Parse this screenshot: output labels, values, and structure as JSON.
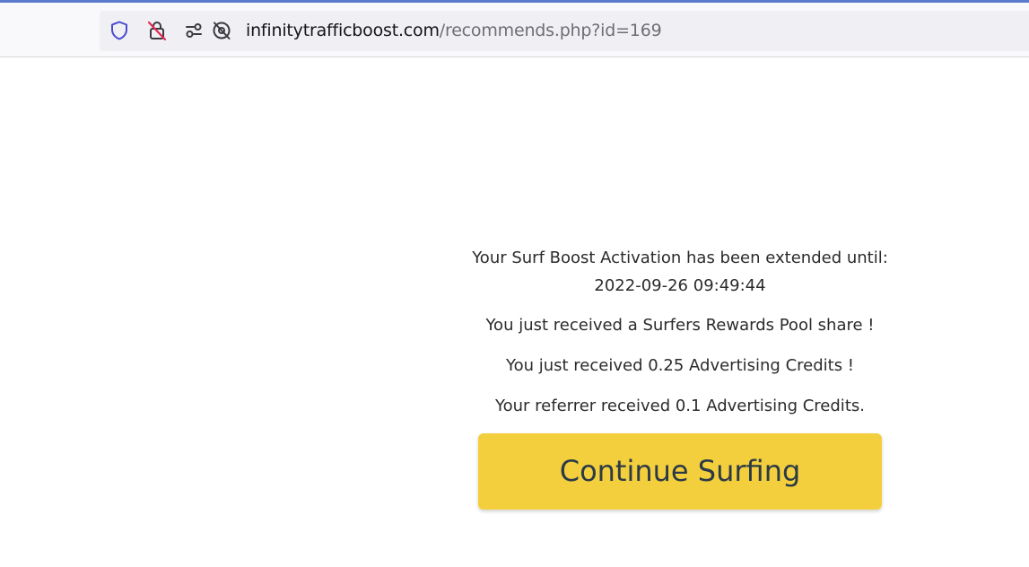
{
  "browser": {
    "url_host": "infinitytrafficboost.com",
    "url_path": "/recommends.php?id=169",
    "icons": [
      "shield-icon",
      "insecure-lock-icon",
      "permissions-icon",
      "tracking-blocked-icon"
    ]
  },
  "messages": {
    "extended": "Your Surf Boost Activation has been extended until:",
    "extended_date": "2022-09-26 09:49:44",
    "pool_share": "You just received a Surfers Rewards Pool share !",
    "credits": "You just received 0.25 Advertising Credits !",
    "referrer": "Your referrer received 0.1 Advertising Credits."
  },
  "actions": {
    "continue_label": "Continue Surfing"
  },
  "colors": {
    "button_bg": "#f4cf3d",
    "button_text": "#2b3a46",
    "accent_line": "#5b7ccc",
    "shield": "#4a4ad0",
    "insecure": "#e22850"
  }
}
